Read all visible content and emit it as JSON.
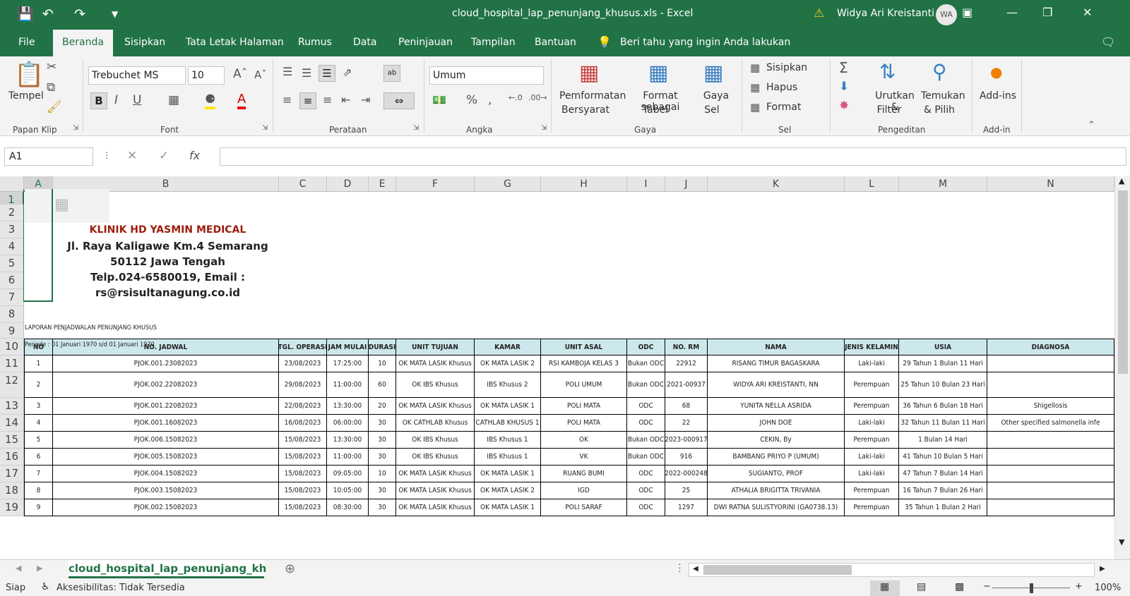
{
  "window": {
    "title": "cloud_hospital_lap_penunjang_khusus.xls  -  Excel",
    "user": "Widya Ari Kreistanti",
    "avatar": "WA"
  },
  "tabs": [
    "File",
    "Beranda",
    "Sisipkan",
    "Tata Letak Halaman",
    "Rumus",
    "Data",
    "Peninjauan",
    "Tampilan",
    "Bantuan"
  ],
  "tell_me": "Beri tahu yang ingin Anda lakukan",
  "ribbon": {
    "clipboard": {
      "paste": "Tempel",
      "group": "Papan Klip"
    },
    "font": {
      "name": "Trebuchet MS",
      "size": "10",
      "group": "Font"
    },
    "alignment": {
      "group": "Perataan"
    },
    "number": {
      "format": "Umum",
      "group": "Angka"
    },
    "styles": {
      "cond_format": "Pemformatan",
      "cond_format2": "Bersyarat",
      "format_table": "Format sebagai",
      "format_table2": "Tabel",
      "cell_styles": "Gaya",
      "cell_styles2": "Sel",
      "group": "Gaya"
    },
    "cells": {
      "insert": "Sisipkan",
      "delete": "Hapus",
      "format": "Format",
      "group": "Sel"
    },
    "editing": {
      "sort": "Urutkan &",
      "sort2": "Filter",
      "find": "Temukan",
      "find2": "& Pilih",
      "group": "Pengeditan"
    },
    "addins": {
      "label": "Add-ins",
      "group": "Add-in"
    }
  },
  "namebox": "A1",
  "columns": [
    "A",
    "B",
    "C",
    "D",
    "E",
    "F",
    "G",
    "H",
    "I",
    "J",
    "K",
    "L",
    "M",
    "N"
  ],
  "rows": [
    "1",
    "2",
    "3",
    "4",
    "5",
    "6",
    "7",
    "8",
    "9",
    "10",
    "11",
    "12",
    "13",
    "14",
    "15",
    "16",
    "17",
    "18",
    "19"
  ],
  "clinic": {
    "name": "KLINIK HD YASMIN MEDICAL",
    "addr1": "Jl. Raya Kaligawe Km.4 Semarang",
    "addr2": "50112 Jawa Tengah",
    "addr3": "Telp.024-6580019, Email :",
    "addr4": "rs@rsisultanagung.co.id"
  },
  "report": {
    "title": "LAPORAN PENJADWALAN PENUNJANG KHUSUS",
    "period": "Periode  : 01 Januari 1970 s/d 01 Januari 1970"
  },
  "table_headers": [
    "NO",
    "NO. JADWAL",
    "TGL. OPERASI",
    "JAM MULAI",
    "DURASI",
    "UNIT TUJUAN",
    "KAMAR",
    "UNIT ASAL",
    "ODC",
    "NO. RM",
    "NAMA",
    "JENIS KELAMIN",
    "USIA",
    "DIAGNOSA"
  ],
  "table_rows": [
    [
      "1",
      "PJOK.001.23082023",
      "23/08/2023",
      "17:25:00",
      "10",
      "OK MATA LASIK Khusus",
      "OK MATA LASIK 2",
      "RSI KAMBOJA KELAS 3",
      "Bukan ODC",
      "22912",
      "RISANG TIMUR BAGASKARA",
      "Laki-laki",
      "29 Tahun 1 Bulan 11 Hari",
      ""
    ],
    [
      "2",
      "PJOK.002.22082023",
      "29/08/2023",
      "11:00:00",
      "60",
      "OK IBS Khusus",
      "IBS Khusus 2",
      "POLI UMUM",
      "Bukan ODC",
      "2021-00937",
      "WIDYA ARI KREISTANTI, NN",
      "Perempuan",
      "25 Tahun 10 Bulan 23 Hari",
      ""
    ],
    [
      "3",
      "PJOK.001.22082023",
      "22/08/2023",
      "13:30:00",
      "20",
      "OK MATA LASIK Khusus",
      "OK MATA LASIK 1",
      "POLI MATA",
      "ODC",
      "68",
      "YUNITA NELLA ASRIDA",
      "Perempuan",
      "36 Tahun 6 Bulan 18 Hari",
      "Shigellosis"
    ],
    [
      "4",
      "PJOK.001.16082023",
      "16/08/2023",
      "06:00:00",
      "30",
      "OK CATHLAB Khusus",
      "CATHLAB KHUSUS 1",
      "POLI MATA",
      "ODC",
      "22",
      "JOHN DOE",
      "Laki-laki",
      "32 Tahun 11 Bulan 11 Hari",
      "Other specified salmonella infe"
    ],
    [
      "5",
      "PJOK.006.15082023",
      "15/08/2023",
      "13:30:00",
      "30",
      "OK IBS Khusus",
      "IBS Khusus 1",
      "OK",
      "Bukan ODC",
      "2023-000917",
      "CEKIN, By",
      "Perempuan",
      "1 Bulan 14 Hari",
      ""
    ],
    [
      "6",
      "PJOK.005.15082023",
      "15/08/2023",
      "11:00:00",
      "30",
      "OK IBS Khusus",
      "IBS Khusus 1",
      "VK",
      "Bukan ODC",
      "916",
      "BAMBANG PRIYO P (UMUM)",
      "Laki-laki",
      "41 Tahun 10 Bulan 5 Hari",
      ""
    ],
    [
      "7",
      "PJOK.004.15082023",
      "15/08/2023",
      "09:05:00",
      "10",
      "OK MATA LASIK Khusus",
      "OK MATA LASIK 1",
      "RUANG BUMI",
      "ODC",
      "2022-000248",
      "SUGIANTO, PROF",
      "Laki-laki",
      "47 Tahun 7 Bulan 14 Hari",
      ""
    ],
    [
      "8",
      "PJOK.003.15082023",
      "15/08/2023",
      "10:05:00",
      "30",
      "OK MATA LASIK Khusus",
      "OK MATA LASIK 2",
      "IGD",
      "ODC",
      "25",
      "ATHALIA BRIGITTA TRIVANIA",
      "Perempuan",
      "16 Tahun 7 Bulan 26 Hari",
      ""
    ],
    [
      "9",
      "PJOK.002.15082023",
      "15/08/2023",
      "08:30:00",
      "30",
      "OK MATA LASIK Khusus",
      "OK MATA LASIK 1",
      "POLI SARAF",
      "ODC",
      "1297",
      "DWI RATNA SULISTYORINI (GA0738.13)",
      "Perempuan",
      "35 Tahun 1 Bulan 2 Hari",
      ""
    ]
  ],
  "sheet_tab": "cloud_hospital_lap_penunjang_kh",
  "status": {
    "ready": "Siap",
    "accessibility": "Aksesibilitas: Tidak Tersedia",
    "zoom": "100%"
  },
  "colors": {
    "excel_green": "#217346",
    "header_fill": "#cde8ec",
    "clinic_red": "#9c1c0e"
  }
}
